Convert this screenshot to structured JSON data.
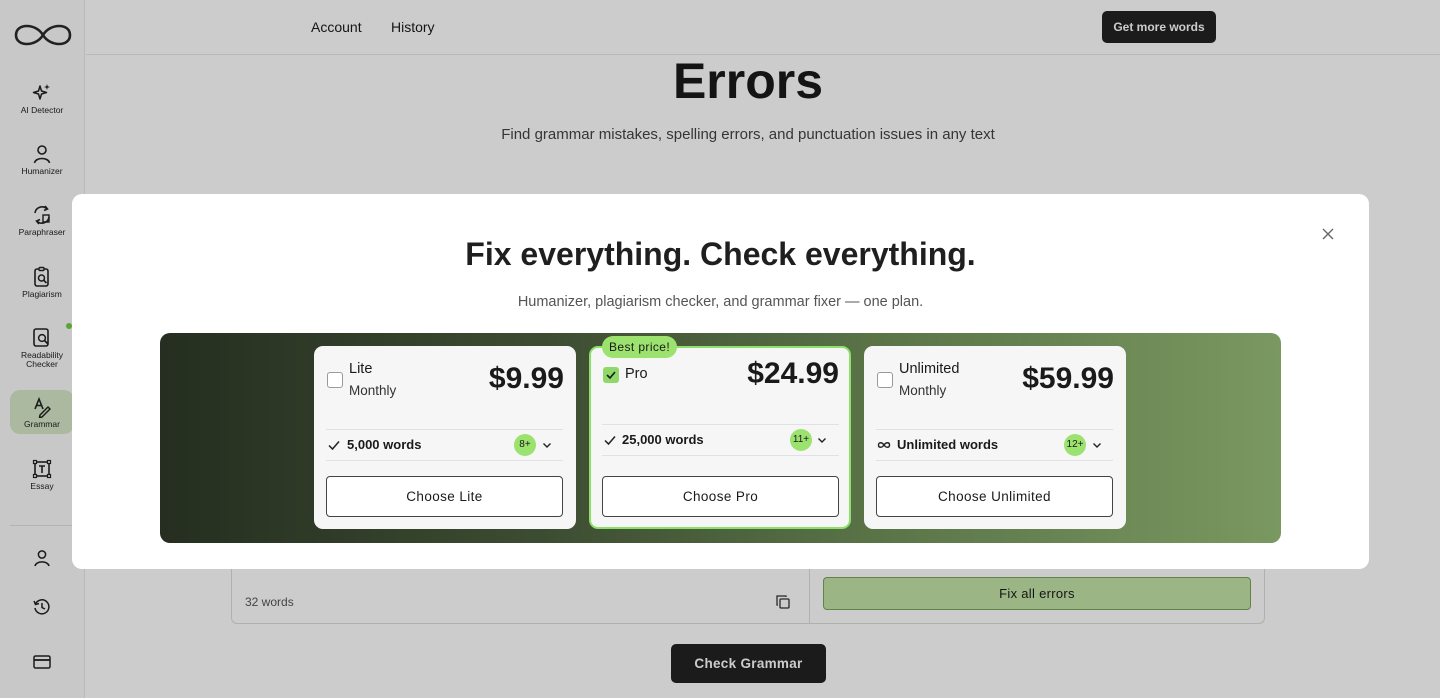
{
  "sidebar": {
    "items": [
      {
        "id": "ai-detector",
        "label": "AI Detector",
        "icon": "sparkle-icon"
      },
      {
        "id": "humanizer",
        "label": "Humanizer",
        "icon": "person-icon"
      },
      {
        "id": "paraphraser",
        "label": "Paraphraser",
        "icon": "paraphrase-icon"
      },
      {
        "id": "plagiarism",
        "label": "Plagiarism",
        "icon": "plagiarism-icon"
      },
      {
        "id": "readability",
        "label": "Readability Checker",
        "icon": "readability-icon"
      },
      {
        "id": "grammar",
        "label": "Grammar",
        "icon": "pen-icon",
        "active": true
      },
      {
        "id": "essay",
        "label": "Essay",
        "icon": "essay-icon"
      }
    ],
    "bottom_icons": [
      "user-icon",
      "history-icon",
      "credit-card-icon"
    ]
  },
  "topbar": {
    "links": [
      "Account",
      "History"
    ],
    "cta_label": "Get more words"
  },
  "page": {
    "title": "Errors",
    "subtitle": "Find grammar mistakes, spelling errors, and punctuation issues in any text",
    "word_count": "32 words",
    "fix_label": "Fix all errors",
    "check_label": "Check Grammar"
  },
  "modal": {
    "title": "Fix everything. Check everything.",
    "subtitle": "Humanizer, plagiarism checker, and grammar fixer — one plan.",
    "plans": [
      {
        "name": "Lite",
        "period": "Monthly",
        "price": "$9.99",
        "feature": "5,000 words",
        "feature_icon": "check-icon",
        "badge": "8+",
        "button": "Choose Lite",
        "selected": false
      },
      {
        "name": "Pro",
        "period": "",
        "price": "$24.99",
        "feature": "25,000 words",
        "feature_icon": "check-icon",
        "badge": "11+",
        "button": "Choose Pro",
        "selected": true,
        "tag": "Best price!"
      },
      {
        "name": "Unlimited",
        "period": "Monthly",
        "price": "$59.99",
        "feature": "Unlimited words",
        "feature_icon": "infinity-icon",
        "badge": "12+",
        "button": "Choose Unlimited",
        "selected": false
      }
    ]
  },
  "colors": {
    "accent_green": "#9ce26f",
    "dark_button": "#222222",
    "band_start": "#252e20",
    "band_end": "#7a9861"
  }
}
